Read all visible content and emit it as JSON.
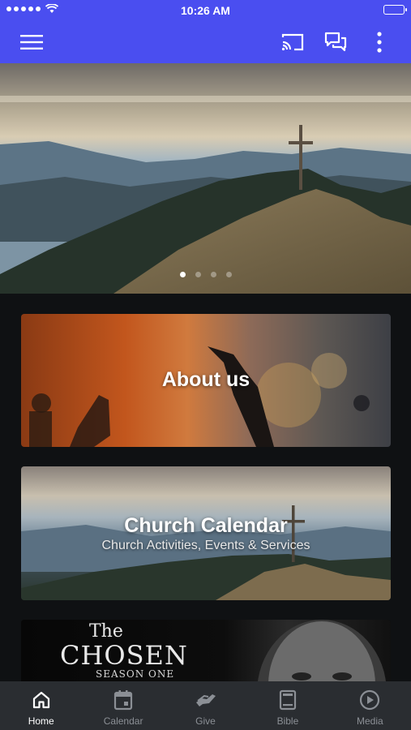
{
  "status_bar": {
    "time": "10:26 AM"
  },
  "colors": {
    "brand": "#4a4ef0",
    "tab_active": "#ffffff",
    "tab_inactive": "#8b8f95",
    "background": "#0f1113"
  },
  "header": {
    "menu_icon": "hamburger-menu-icon",
    "actions": [
      "cast-icon",
      "chat-icon",
      "more-vertical-icon"
    ]
  },
  "carousel": {
    "slide_count": 4,
    "active_index": 0
  },
  "cards": {
    "about": {
      "title": "About us"
    },
    "calendar": {
      "title": "Church Calendar",
      "subtitle": "Church Activities, Events & Services"
    },
    "chosen": {
      "title_line1": "The",
      "title_line2": "CHOSEN",
      "title_line3": "SEASON ONE"
    }
  },
  "tabs": [
    {
      "label": "Home",
      "icon": "home-icon"
    },
    {
      "label": "Calendar",
      "icon": "calendar-icon"
    },
    {
      "label": "Give",
      "icon": "give-hand-icon"
    },
    {
      "label": "Bible",
      "icon": "bible-icon"
    },
    {
      "label": "Media",
      "icon": "play-circle-icon"
    }
  ]
}
